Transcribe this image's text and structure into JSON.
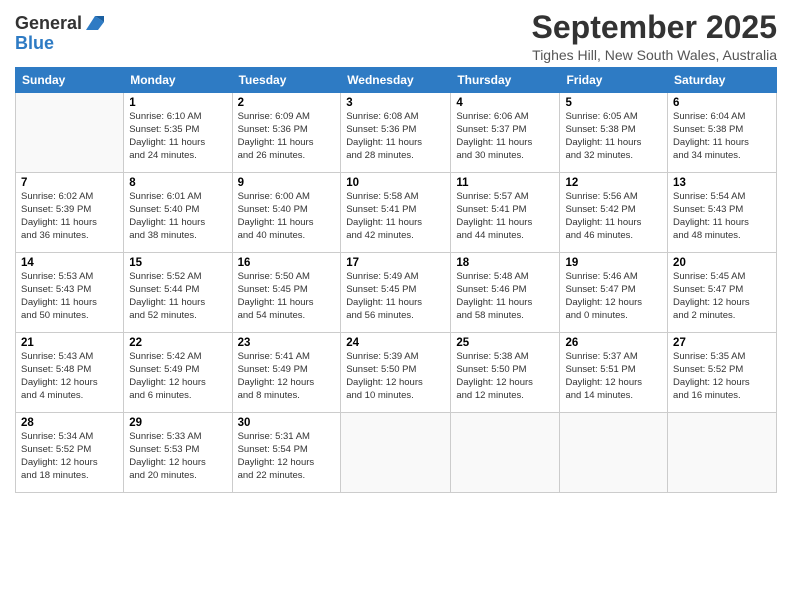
{
  "logo": {
    "general": "General",
    "blue": "Blue"
  },
  "header": {
    "month": "September 2025",
    "location": "Tighes Hill, New South Wales, Australia"
  },
  "weekdays": [
    "Sunday",
    "Monday",
    "Tuesday",
    "Wednesday",
    "Thursday",
    "Friday",
    "Saturday"
  ],
  "weeks": [
    [
      {
        "day": "",
        "info": ""
      },
      {
        "day": "1",
        "info": "Sunrise: 6:10 AM\nSunset: 5:35 PM\nDaylight: 11 hours\nand 24 minutes."
      },
      {
        "day": "2",
        "info": "Sunrise: 6:09 AM\nSunset: 5:36 PM\nDaylight: 11 hours\nand 26 minutes."
      },
      {
        "day": "3",
        "info": "Sunrise: 6:08 AM\nSunset: 5:36 PM\nDaylight: 11 hours\nand 28 minutes."
      },
      {
        "day": "4",
        "info": "Sunrise: 6:06 AM\nSunset: 5:37 PM\nDaylight: 11 hours\nand 30 minutes."
      },
      {
        "day": "5",
        "info": "Sunrise: 6:05 AM\nSunset: 5:38 PM\nDaylight: 11 hours\nand 32 minutes."
      },
      {
        "day": "6",
        "info": "Sunrise: 6:04 AM\nSunset: 5:38 PM\nDaylight: 11 hours\nand 34 minutes."
      }
    ],
    [
      {
        "day": "7",
        "info": "Sunrise: 6:02 AM\nSunset: 5:39 PM\nDaylight: 11 hours\nand 36 minutes."
      },
      {
        "day": "8",
        "info": "Sunrise: 6:01 AM\nSunset: 5:40 PM\nDaylight: 11 hours\nand 38 minutes."
      },
      {
        "day": "9",
        "info": "Sunrise: 6:00 AM\nSunset: 5:40 PM\nDaylight: 11 hours\nand 40 minutes."
      },
      {
        "day": "10",
        "info": "Sunrise: 5:58 AM\nSunset: 5:41 PM\nDaylight: 11 hours\nand 42 minutes."
      },
      {
        "day": "11",
        "info": "Sunrise: 5:57 AM\nSunset: 5:41 PM\nDaylight: 11 hours\nand 44 minutes."
      },
      {
        "day": "12",
        "info": "Sunrise: 5:56 AM\nSunset: 5:42 PM\nDaylight: 11 hours\nand 46 minutes."
      },
      {
        "day": "13",
        "info": "Sunrise: 5:54 AM\nSunset: 5:43 PM\nDaylight: 11 hours\nand 48 minutes."
      }
    ],
    [
      {
        "day": "14",
        "info": "Sunrise: 5:53 AM\nSunset: 5:43 PM\nDaylight: 11 hours\nand 50 minutes."
      },
      {
        "day": "15",
        "info": "Sunrise: 5:52 AM\nSunset: 5:44 PM\nDaylight: 11 hours\nand 52 minutes."
      },
      {
        "day": "16",
        "info": "Sunrise: 5:50 AM\nSunset: 5:45 PM\nDaylight: 11 hours\nand 54 minutes."
      },
      {
        "day": "17",
        "info": "Sunrise: 5:49 AM\nSunset: 5:45 PM\nDaylight: 11 hours\nand 56 minutes."
      },
      {
        "day": "18",
        "info": "Sunrise: 5:48 AM\nSunset: 5:46 PM\nDaylight: 11 hours\nand 58 minutes."
      },
      {
        "day": "19",
        "info": "Sunrise: 5:46 AM\nSunset: 5:47 PM\nDaylight: 12 hours\nand 0 minutes."
      },
      {
        "day": "20",
        "info": "Sunrise: 5:45 AM\nSunset: 5:47 PM\nDaylight: 12 hours\nand 2 minutes."
      }
    ],
    [
      {
        "day": "21",
        "info": "Sunrise: 5:43 AM\nSunset: 5:48 PM\nDaylight: 12 hours\nand 4 minutes."
      },
      {
        "day": "22",
        "info": "Sunrise: 5:42 AM\nSunset: 5:49 PM\nDaylight: 12 hours\nand 6 minutes."
      },
      {
        "day": "23",
        "info": "Sunrise: 5:41 AM\nSunset: 5:49 PM\nDaylight: 12 hours\nand 8 minutes."
      },
      {
        "day": "24",
        "info": "Sunrise: 5:39 AM\nSunset: 5:50 PM\nDaylight: 12 hours\nand 10 minutes."
      },
      {
        "day": "25",
        "info": "Sunrise: 5:38 AM\nSunset: 5:50 PM\nDaylight: 12 hours\nand 12 minutes."
      },
      {
        "day": "26",
        "info": "Sunrise: 5:37 AM\nSunset: 5:51 PM\nDaylight: 12 hours\nand 14 minutes."
      },
      {
        "day": "27",
        "info": "Sunrise: 5:35 AM\nSunset: 5:52 PM\nDaylight: 12 hours\nand 16 minutes."
      }
    ],
    [
      {
        "day": "28",
        "info": "Sunrise: 5:34 AM\nSunset: 5:52 PM\nDaylight: 12 hours\nand 18 minutes."
      },
      {
        "day": "29",
        "info": "Sunrise: 5:33 AM\nSunset: 5:53 PM\nDaylight: 12 hours\nand 20 minutes."
      },
      {
        "day": "30",
        "info": "Sunrise: 5:31 AM\nSunset: 5:54 PM\nDaylight: 12 hours\nand 22 minutes."
      },
      {
        "day": "",
        "info": ""
      },
      {
        "day": "",
        "info": ""
      },
      {
        "day": "",
        "info": ""
      },
      {
        "day": "",
        "info": ""
      }
    ]
  ]
}
